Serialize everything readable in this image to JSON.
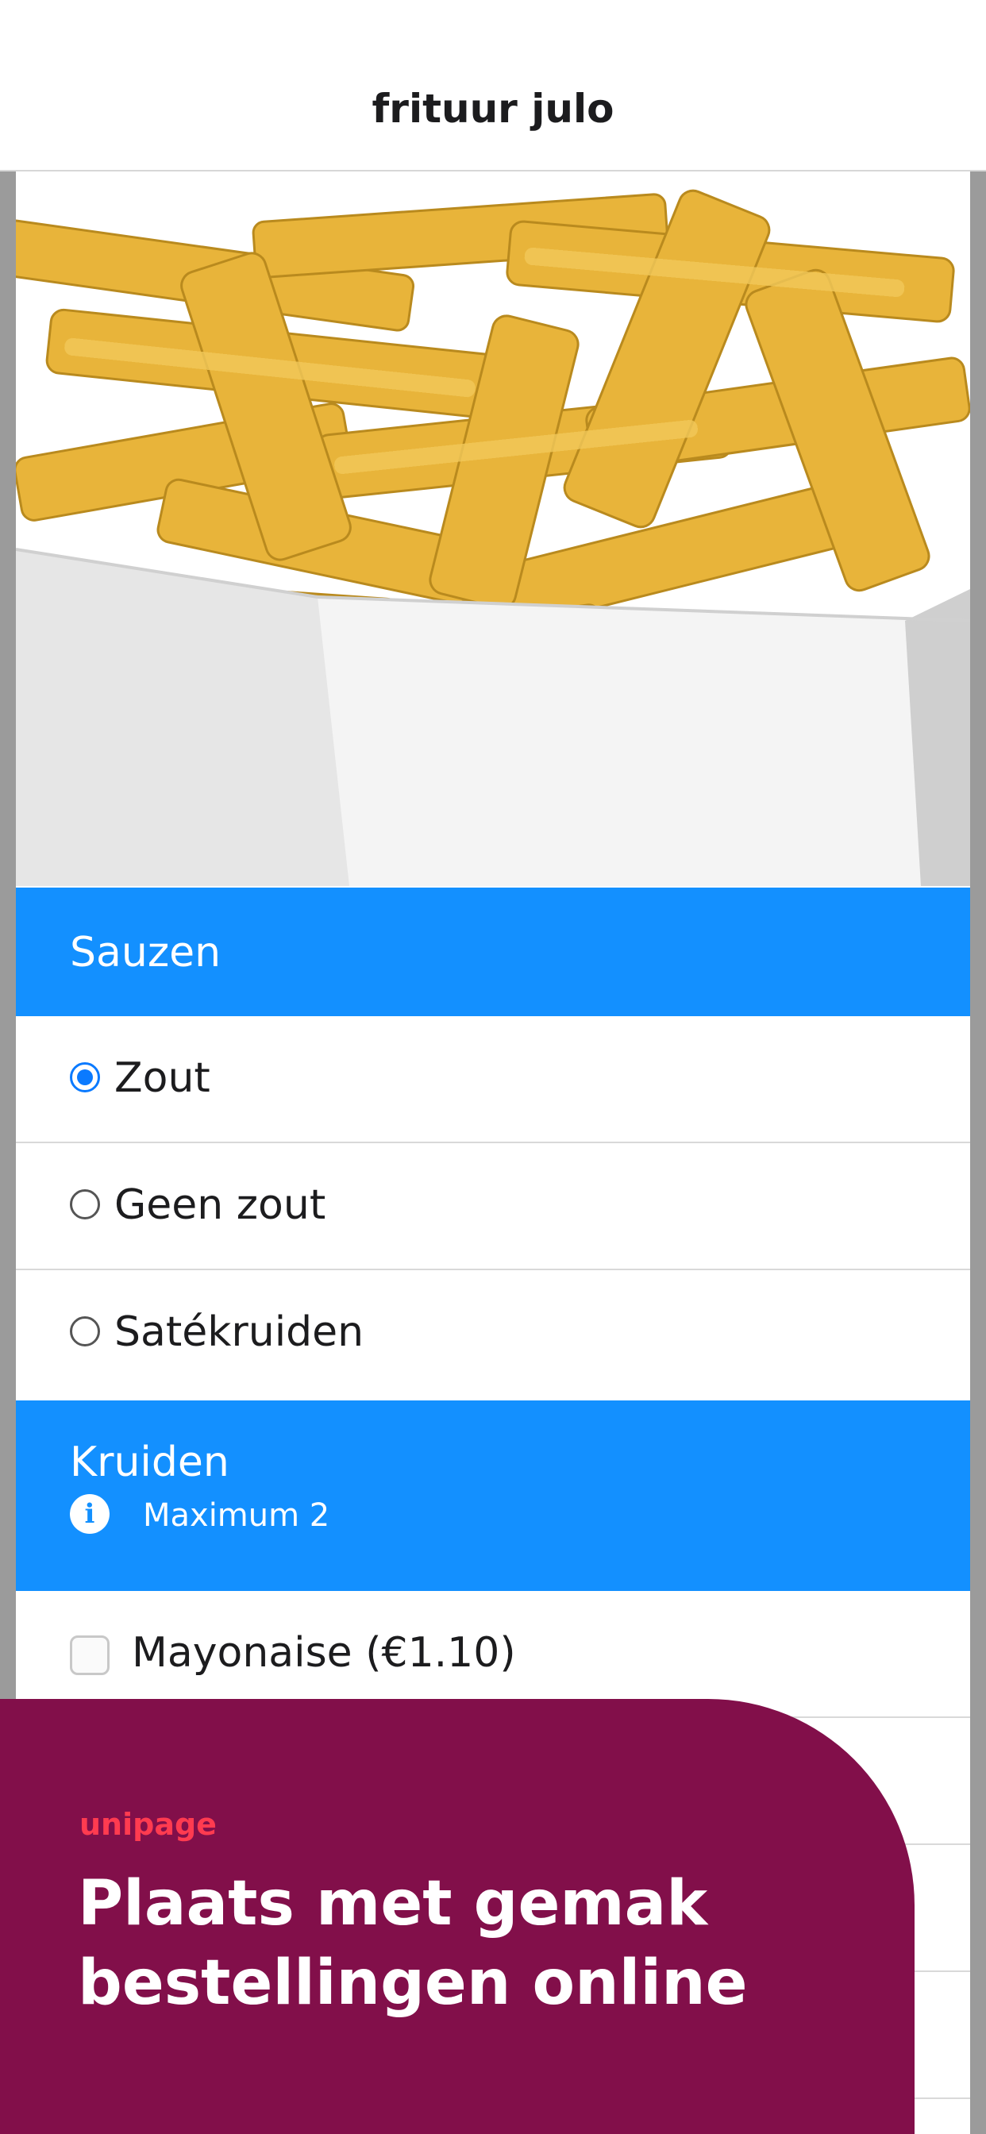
{
  "header": {
    "title": "frituur julo"
  },
  "hero": {
    "image": "fries-in-paper-tray"
  },
  "sections": {
    "sauzen": {
      "title": "Sauzen",
      "options": [
        {
          "label": "Zout",
          "selected": true
        },
        {
          "label": "Geen zout",
          "selected": false
        },
        {
          "label": "Satékruiden",
          "selected": false
        }
      ]
    },
    "kruiden": {
      "title": "Kruiden",
      "info_icon": "info-icon",
      "info": "Maximum 2",
      "options": [
        {
          "label": "Mayonaise (€1.10)",
          "checked": false
        }
      ]
    }
  },
  "promo": {
    "brand": "unipage",
    "headline_line1": "Plaats met gemak",
    "headline_line2": "bestellingen online"
  },
  "colors": {
    "section_header": "#1390ff",
    "radio_selected": "#0a7aff",
    "promo_background": "#820f4a",
    "promo_brand": "#ff3b50"
  }
}
